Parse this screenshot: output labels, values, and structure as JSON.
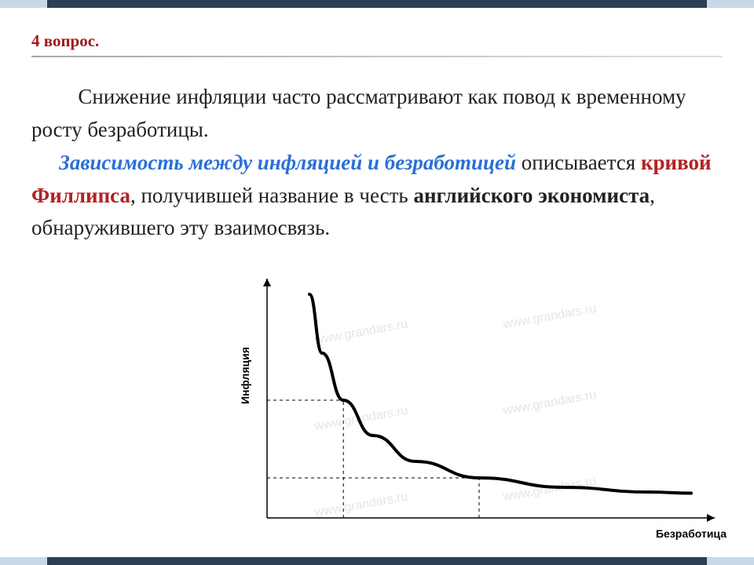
{
  "heading": "4 вопрос.",
  "text": {
    "p1": "Снижение инфляции часто рассматривают как повод к временному росту безработицы.",
    "dep_lead": "Зависимость между инфляцией и безработицей",
    "desc_verb": " описывается ",
    "curve_name": "кривой Филлипса",
    "desc_tail1": ", получившей название в честь ",
    "economist": "английского экономиста",
    "desc_tail2": ", обнаружившего эту взаимосвязь."
  },
  "chart_data": {
    "type": "line",
    "title": "",
    "xlabel": "Безработица",
    "ylabel": "Инфляция",
    "xlim": [
      0,
      10
    ],
    "ylim": [
      0,
      10
    ],
    "series": [
      {
        "name": "Кривая Филлипса",
        "x": [
          1.0,
          1.3,
          1.8,
          2.5,
          3.5,
          5.0,
          7.0,
          9.0,
          10.0
        ],
        "y": [
          9.5,
          7.0,
          5.0,
          3.5,
          2.4,
          1.7,
          1.3,
          1.1,
          1.05
        ]
      }
    ],
    "guides": [
      {
        "x": 1.8,
        "y": 5.0
      },
      {
        "x": 5.0,
        "y": 1.7
      }
    ],
    "watermark": "www.grandars.ru"
  }
}
